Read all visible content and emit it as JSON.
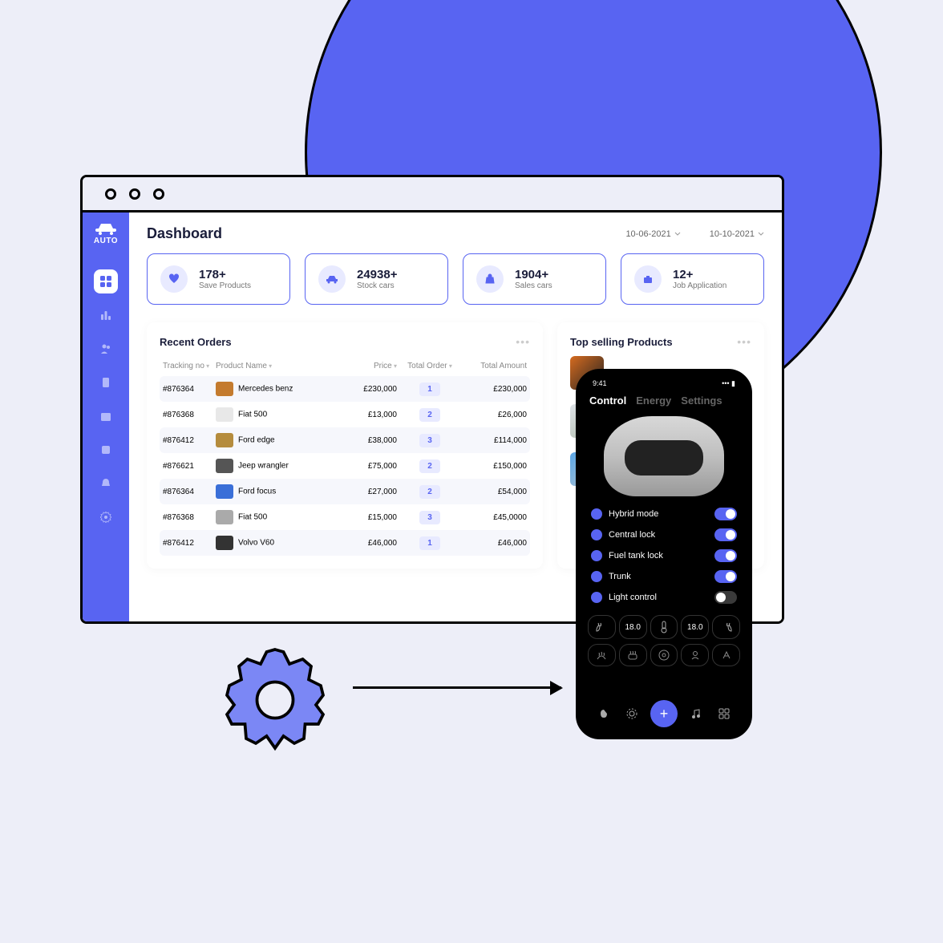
{
  "logo_text": "AUTO",
  "dashboard": {
    "title": "Dashboard",
    "date_from": "10-06-2021",
    "date_to": "10-10-2021"
  },
  "cards": [
    {
      "value": "178+",
      "label": "Save Products",
      "icon": "heart"
    },
    {
      "value": "24938+",
      "label": "Stock cars",
      "icon": "car"
    },
    {
      "value": "1904+",
      "label": "Sales cars",
      "icon": "bag"
    },
    {
      "value": "12+",
      "label": "Job Application",
      "icon": "briefcase"
    }
  ],
  "orders": {
    "title": "Recent Orders",
    "columns": [
      "Tracking no",
      "Product Name",
      "Price",
      "Total Order",
      "Total Amount"
    ],
    "rows": [
      {
        "tracking": "#876364",
        "name": "Mercedes benz",
        "price": "£230,000",
        "qty": "1",
        "amount": "£230,000",
        "col": "#c47b2e"
      },
      {
        "tracking": "#876368",
        "name": "Fiat 500",
        "price": "£13,000",
        "qty": "2",
        "amount": "£26,000",
        "col": "#e8e8e8"
      },
      {
        "tracking": "#876412",
        "name": "Ford edge",
        "price": "£38,000",
        "qty": "3",
        "amount": "£114,000",
        "col": "#b58c3d"
      },
      {
        "tracking": "#876621",
        "name": "Jeep wrangler",
        "price": "£75,000",
        "qty": "2",
        "amount": "£150,000",
        "col": "#555"
      },
      {
        "tracking": "#876364",
        "name": "Ford focus",
        "price": "£27,000",
        "qty": "2",
        "amount": "£54,000",
        "col": "#3a6fd8"
      },
      {
        "tracking": "#876368",
        "name": "Fiat 500",
        "price": "£15,000",
        "qty": "3",
        "amount": "£45,0000",
        "col": "#aaa"
      },
      {
        "tracking": "#876412",
        "name": "Volvo V60",
        "price": "£46,000",
        "qty": "1",
        "amount": "£46,000",
        "col": "#333"
      }
    ]
  },
  "top_selling": {
    "title": "Top selling Products",
    "items": [
      {
        "col1": "#d66b1f",
        "col2": "#222"
      },
      {
        "col1": "#dfe3e8",
        "col2": "#a7b4a0"
      },
      {
        "col1": "#5aa6e6",
        "col2": "#b9c4cc"
      }
    ]
  },
  "mobile": {
    "time": "9:41",
    "tabs": {
      "control": "Control",
      "energy": "Energy",
      "settings": "Settings"
    },
    "controls": [
      {
        "label": "Hybrid mode",
        "on": true
      },
      {
        "label": "Central lock",
        "on": true
      },
      {
        "label": "Fuel tank lock",
        "on": true
      },
      {
        "label": "Trunk",
        "on": true
      },
      {
        "label": "Light control",
        "on": false
      }
    ],
    "temp_left": "18.0",
    "temp_right": "18.0"
  }
}
